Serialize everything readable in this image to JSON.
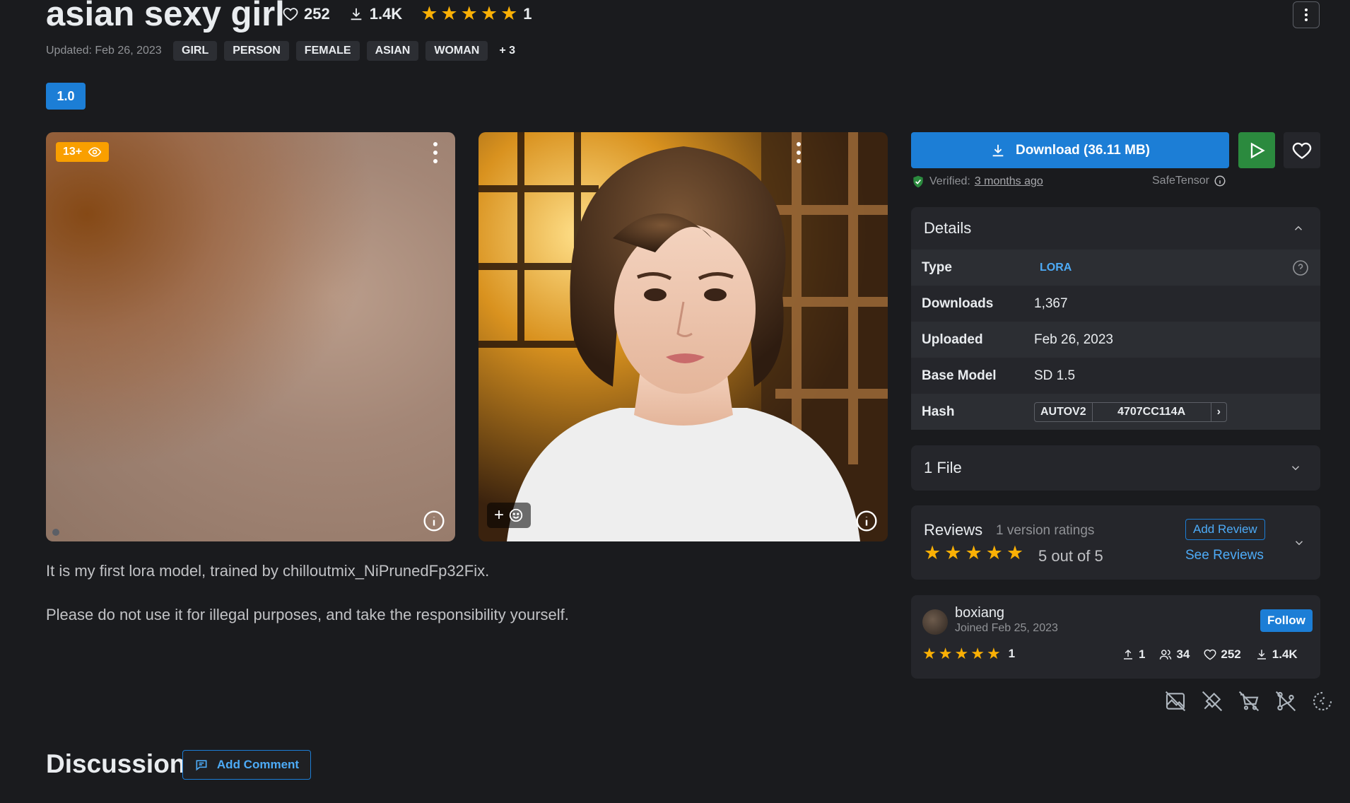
{
  "header": {
    "title": "asian sexy girl",
    "likes": "252",
    "downloads": "1.4K",
    "rating_count": "1",
    "updated": "Updated: Feb 26, 2023",
    "tags": [
      "GIRL",
      "PERSON",
      "FEMALE",
      "ASIAN",
      "WOMAN",
      "+ 3"
    ]
  },
  "version_badge": "1.0",
  "images": {
    "left_badge": "13+"
  },
  "description": {
    "line1": "It is my first lora model, trained by chilloutmix_NiPrunedFp32Fix.",
    "line2": "Please do not use it for illegal purposes, and take the responsibility yourself."
  },
  "discussion": {
    "title": "Discussion",
    "add_comment": "Add Comment"
  },
  "download": {
    "label": "Download (36.11 MB)",
    "verified_prefix": "Verified:",
    "verified_time": "3 months ago",
    "format": "SafeTensor"
  },
  "details": {
    "title": "Details",
    "rows": [
      {
        "label": "Type",
        "value": "LORA"
      },
      {
        "label": "Downloads",
        "value": "1,367"
      },
      {
        "label": "Uploaded",
        "value": "Feb 26, 2023"
      },
      {
        "label": "Base Model",
        "value": "SD 1.5"
      },
      {
        "label": "Hash",
        "hash_type": "AUTOV2",
        "hash_value": "4707CC114A"
      }
    ]
  },
  "files": {
    "label": "1 File"
  },
  "reviews": {
    "title": "Reviews",
    "count_text": "1 version ratings",
    "score_text": "5 out of 5",
    "add_review": "Add Review",
    "see_reviews": "See Reviews"
  },
  "creator": {
    "name": "boxiang",
    "joined": "Joined Feb 25, 2023",
    "follow": "Follow",
    "rating_count": "1",
    "uploads": "1",
    "followers": "34",
    "likes": "252",
    "downloads": "1.4K"
  },
  "colors": {
    "accent": "#1c7ed6",
    "star": "#fab005",
    "play": "#2b8a3e",
    "badge": "#f59f00",
    "background": "#1a1b1e",
    "panel": "#25262b"
  }
}
